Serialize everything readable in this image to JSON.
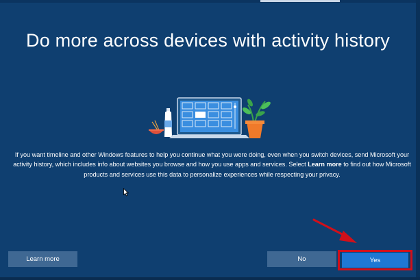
{
  "window": {
    "title": "Do more across devices with activity history"
  },
  "content": {
    "body_text_before": "If you want timeline and other Windows features to help you continue what you were doing, even when you switch devices, send Microsoft your activity history, which includes info about websites you browse and how you use apps and services. Select ",
    "learn_more_inline": "Learn more",
    "body_text_after": " to find out how Microsoft products and services use this data to personalize experiences while respecting your privacy."
  },
  "buttons": {
    "learn_more": "Learn more",
    "no": "No",
    "yes": "Yes"
  },
  "icons": {
    "illustration": "laptop-with-plant-and-bottle-illustration",
    "cursor": "mouse-pointer-icon",
    "annotation": "red-arrow-annotation"
  },
  "colors": {
    "background": "#0f3f70",
    "button": "#3f6893",
    "primary_button": "#1e78d4",
    "highlight": "#d0101a"
  }
}
